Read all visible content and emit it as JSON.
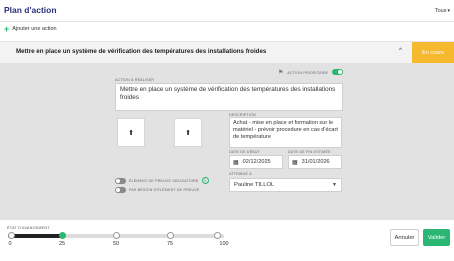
{
  "header": {
    "title": "Plan d'action",
    "filter_label": "Tous"
  },
  "toolbar": {
    "add_action_label": "Ajouter une action"
  },
  "action": {
    "title": "Mettre en place un système de vérification des températures des installations froides",
    "status": "En cours",
    "status_color": "#f6b82e"
  },
  "form": {
    "priority_label": "ACTION PRIORITAIRE",
    "priority_on": true,
    "action_label": "ACTION À RÉALISER",
    "action_value": "Mettre en place un système de vérification des températures des installations froides",
    "description_label": "DESCRIPTION",
    "description_value": "Achat - mise en place et formation sur le matériel - prévoir procedure en cas d'écart de température",
    "start_label": "DATE DE DÉBUT",
    "start_value": "02/12/2025",
    "end_label": "DATE DE FIN ESTIMÉE",
    "end_value": "31/01/2026",
    "assigned_label": "ATTRIBUÉ À",
    "assigned_value": "Pauline TILLOL",
    "proof_required_label": "ÉLÉMENT DE PREUVE OBLIGATOIRE",
    "proof_missing_label": "PAS BESOIN D'ÉLÉMENT DE PREUVE",
    "upload_icon": "upload-icon"
  },
  "progress": {
    "label": "ÉTAT D'AVANCEMENT",
    "value": 25,
    "ticks": [
      "0",
      "25",
      "50",
      "75",
      "100"
    ]
  },
  "buttons": {
    "cancel": "Annuler",
    "save": "Valider"
  },
  "colors": {
    "accent": "#2bb673",
    "title": "#2a2f7a",
    "status": "#f6b82e"
  }
}
